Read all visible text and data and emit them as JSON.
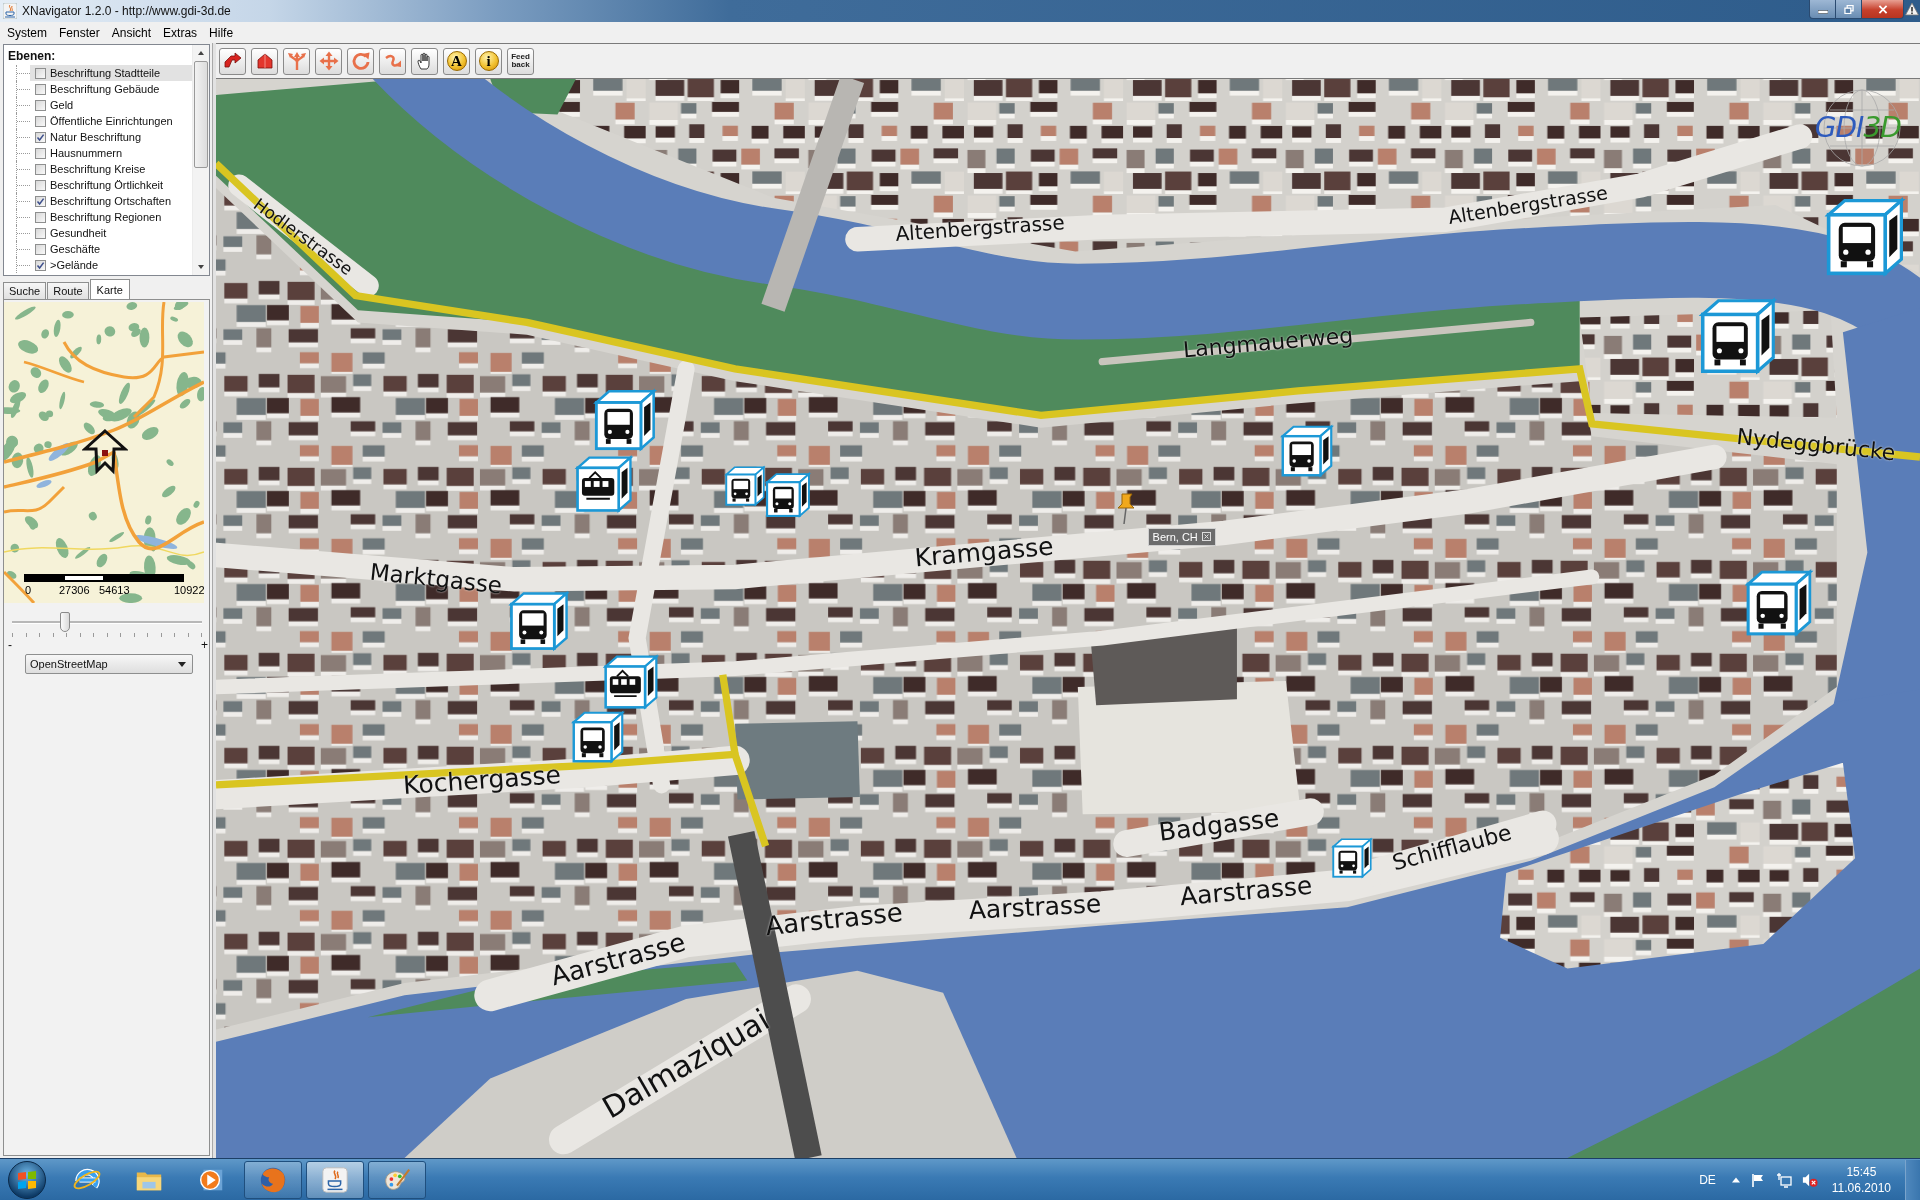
{
  "window": {
    "title": "XNavigator 1.2.0 - http://www.gdi-3d.de",
    "maximized": true
  },
  "menu": [
    "System",
    "Fenster",
    "Ansicht",
    "Extras",
    "Hilfe"
  ],
  "layers": {
    "heading": "Ebenen:",
    "items": [
      {
        "label": "Beschriftung Stadtteile",
        "checked": false,
        "selected": true
      },
      {
        "label": "Beschriftung Gebäude",
        "checked": false,
        "selected": false
      },
      {
        "label": "Geld",
        "checked": false,
        "selected": false
      },
      {
        "label": "Öffentliche Einrichtungen",
        "checked": false,
        "selected": false
      },
      {
        "label": "Natur Beschriftung",
        "checked": true,
        "selected": false
      },
      {
        "label": "Hausnummern",
        "checked": false,
        "selected": false
      },
      {
        "label": "Beschriftung Kreise",
        "checked": false,
        "selected": false
      },
      {
        "label": "Beschriftung Örtlichkeit",
        "checked": false,
        "selected": false
      },
      {
        "label": "Beschriftung Ortschaften",
        "checked": true,
        "selected": false
      },
      {
        "label": "Beschriftung Regionen",
        "checked": false,
        "selected": false
      },
      {
        "label": "Gesundheit",
        "checked": false,
        "selected": false
      },
      {
        "label": "Geschäfte",
        "checked": false,
        "selected": false
      },
      {
        "label": ">Gelände",
        "checked": true,
        "selected": false
      }
    ]
  },
  "side_tabs": [
    {
      "label": "Suche",
      "selected": false
    },
    {
      "label": "Route",
      "selected": false
    },
    {
      "label": "Karte",
      "selected": true
    }
  ],
  "overview_map": {
    "scale_labels": [
      "0",
      "27306",
      "54613",
      "10922"
    ],
    "zoom_slider": {
      "minus": "-",
      "plus": "+",
      "level": 0.28
    },
    "map_source": "OpenStreetMap"
  },
  "toolbar": [
    {
      "kind": "icon"
    },
    {
      "kind": "icon"
    },
    {
      "kind": "icon"
    },
    {
      "kind": "icon"
    },
    {
      "kind": "icon"
    },
    {
      "kind": "icon"
    },
    {
      "kind": "icon"
    },
    {
      "kind": "glyph",
      "glyph": "A"
    },
    {
      "kind": "glyph",
      "glyph": "i"
    },
    {
      "kind": "text",
      "label": "Feed back"
    }
  ],
  "map": {
    "street_labels": [
      "Hodlerstrasse",
      "Altenbergstrasse",
      "Altenbergstrasse",
      "Langmauerweg",
      "Nydeggbrücke",
      "Marktgasse",
      "Kramgasse",
      "Kochergasse",
      "Badgasse",
      "Schifflaube",
      "Aarstrasse",
      "Aarstrasse",
      "Aarstrasse",
      "Aarstrasse",
      "Dalmaziquai"
    ],
    "pin_label": "Bern, CH",
    "logo": [
      "GDI",
      "3D"
    ]
  },
  "taskbar": {
    "items": [
      {
        "kind": "pinned",
        "selected": false
      },
      {
        "kind": "pinned",
        "selected": false
      },
      {
        "kind": "pinned",
        "selected": false
      },
      {
        "kind": "running",
        "selected": false
      },
      {
        "kind": "running",
        "selected": true
      },
      {
        "kind": "running",
        "selected": false
      }
    ],
    "language": "DE",
    "sound_muted": true,
    "time": "15:45",
    "date": "11.06.2010"
  }
}
